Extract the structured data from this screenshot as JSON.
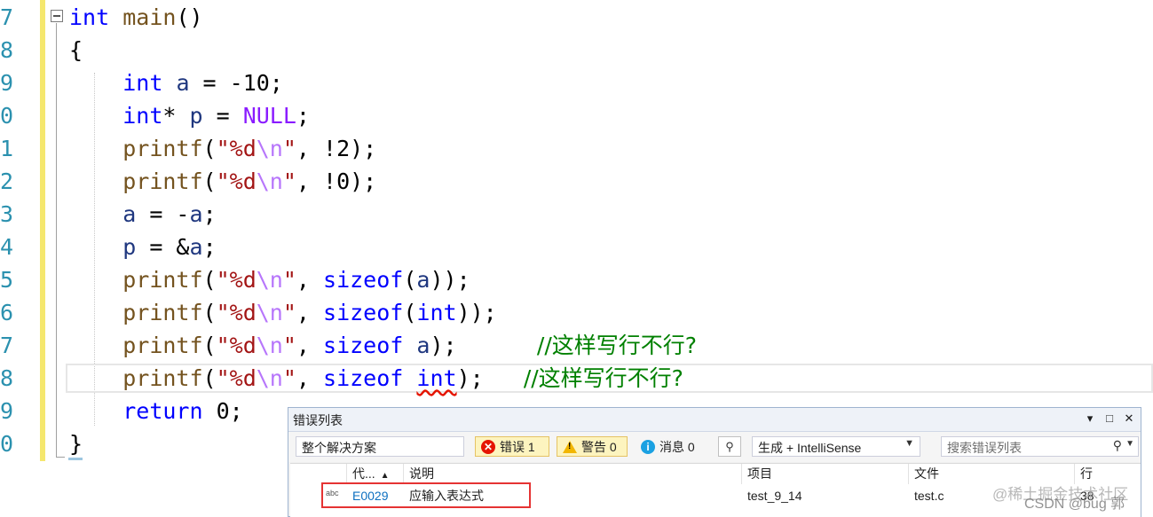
{
  "editor": {
    "line_numbers": [
      "7",
      "8",
      "9",
      "0",
      "1",
      "2",
      "3",
      "4",
      "5",
      "6",
      "7",
      "8",
      "9",
      "0"
    ],
    "lines": [
      [
        {
          "t": "int",
          "c": "kw"
        },
        {
          "t": " "
        },
        {
          "t": "main",
          "c": "fn"
        },
        {
          "t": "()"
        }
      ],
      [
        {
          "t": "{"
        }
      ],
      [
        {
          "t": "    "
        },
        {
          "t": "int",
          "c": "kw"
        },
        {
          "t": " "
        },
        {
          "t": "a",
          "c": "var"
        },
        {
          "t": " = -10;"
        }
      ],
      [
        {
          "t": "    "
        },
        {
          "t": "int",
          "c": "kw"
        },
        {
          "t": "* "
        },
        {
          "t": "p",
          "c": "var"
        },
        {
          "t": " = "
        },
        {
          "t": "NULL",
          "c": "mac"
        },
        {
          "t": ";"
        }
      ],
      [
        {
          "t": "    "
        },
        {
          "t": "printf",
          "c": "fn"
        },
        {
          "t": "("
        },
        {
          "t": "\"%d",
          "c": "str"
        },
        {
          "t": "\\n",
          "c": "esc"
        },
        {
          "t": "\"",
          "c": "str"
        },
        {
          "t": ", !2);"
        }
      ],
      [
        {
          "t": "    "
        },
        {
          "t": "printf",
          "c": "fn"
        },
        {
          "t": "("
        },
        {
          "t": "\"%d",
          "c": "str"
        },
        {
          "t": "\\n",
          "c": "esc"
        },
        {
          "t": "\"",
          "c": "str"
        },
        {
          "t": ", !0);"
        }
      ],
      [
        {
          "t": "    "
        },
        {
          "t": "a",
          "c": "var"
        },
        {
          "t": " = -"
        },
        {
          "t": "a",
          "c": "var"
        },
        {
          "t": ";"
        }
      ],
      [
        {
          "t": "    "
        },
        {
          "t": "p",
          "c": "var"
        },
        {
          "t": " = &"
        },
        {
          "t": "a",
          "c": "var"
        },
        {
          "t": ";"
        }
      ],
      [
        {
          "t": "    "
        },
        {
          "t": "printf",
          "c": "fn"
        },
        {
          "t": "("
        },
        {
          "t": "\"%d",
          "c": "str"
        },
        {
          "t": "\\n",
          "c": "esc"
        },
        {
          "t": "\"",
          "c": "str"
        },
        {
          "t": ", "
        },
        {
          "t": "sizeof",
          "c": "kw"
        },
        {
          "t": "("
        },
        {
          "t": "a",
          "c": "var"
        },
        {
          "t": "));"
        }
      ],
      [
        {
          "t": "    "
        },
        {
          "t": "printf",
          "c": "fn"
        },
        {
          "t": "("
        },
        {
          "t": "\"%d",
          "c": "str"
        },
        {
          "t": "\\n",
          "c": "esc"
        },
        {
          "t": "\"",
          "c": "str"
        },
        {
          "t": ", "
        },
        {
          "t": "sizeof",
          "c": "kw"
        },
        {
          "t": "("
        },
        {
          "t": "int",
          "c": "kw"
        },
        {
          "t": "));"
        }
      ],
      [
        {
          "t": "    "
        },
        {
          "t": "printf",
          "c": "fn"
        },
        {
          "t": "("
        },
        {
          "t": "\"%d",
          "c": "str"
        },
        {
          "t": "\\n",
          "c": "esc"
        },
        {
          "t": "\"",
          "c": "str"
        },
        {
          "t": ", "
        },
        {
          "t": "sizeof",
          "c": "kw"
        },
        {
          "t": " "
        },
        {
          "t": "a",
          "c": "var"
        },
        {
          "t": ");      "
        },
        {
          "t": "//这样写行不行?",
          "c": "cmt"
        }
      ],
      [
        {
          "t": "    "
        },
        {
          "t": "printf",
          "c": "fn"
        },
        {
          "t": "("
        },
        {
          "t": "\"%d",
          "c": "str"
        },
        {
          "t": "\\n",
          "c": "esc"
        },
        {
          "t": "\"",
          "c": "str"
        },
        {
          "t": ", "
        },
        {
          "t": "sizeof",
          "c": "kw"
        },
        {
          "t": " "
        },
        {
          "t": "int",
          "c": "kw squig"
        },
        {
          "t": ");   "
        },
        {
          "t": "//这样写行不行?",
          "c": "cmt"
        }
      ],
      [
        {
          "t": "    "
        },
        {
          "t": "return",
          "c": "kw"
        },
        {
          "t": " 0;"
        }
      ],
      [
        {
          "t": "}"
        }
      ]
    ]
  },
  "error_list": {
    "title": "错误列表",
    "window_buttons": {
      "dropdown": "▾",
      "maximize": "□",
      "close": "✕"
    },
    "scope": "整个解决方案",
    "errors_label": "错误 1",
    "warnings_label": "警告 0",
    "messages_label": "消息 0",
    "build_filter": "生成 + IntelliSense",
    "search_placeholder": "搜索错误列表",
    "columns": {
      "code": "代...",
      "description": "说明",
      "project": "项目",
      "file": "文件",
      "line": "行"
    },
    "rows": [
      {
        "code": "E0029",
        "description": "应输入表达式",
        "project": "test_9_14",
        "file": "test.c",
        "line": "38"
      }
    ]
  },
  "watermark": {
    "line1": "@稀土掘金技术社区",
    "line2": "CSDN @bug 郭"
  },
  "colors": {
    "keyword": "#0000ff",
    "function": "#74531f",
    "string": "#a31515",
    "comment": "#008000",
    "annotation": "#e53333"
  }
}
